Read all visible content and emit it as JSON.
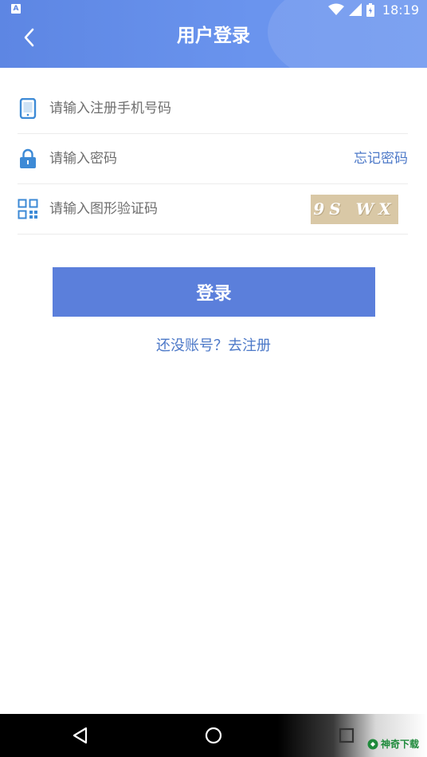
{
  "status_bar": {
    "left_icon_letter": "A",
    "time": "18:19"
  },
  "header": {
    "title": "用户登录"
  },
  "form": {
    "phone_placeholder": "请输入注册手机号码",
    "password_placeholder": "请输入密码",
    "forgot_label": "忘记密码",
    "captcha_placeholder": "请输入图形验证码",
    "captcha_text": "9S WX"
  },
  "login_button_label": "登录",
  "register": {
    "prompt": "还没账号？",
    "action": "去注册"
  },
  "watermark": "神奇下载",
  "colors": {
    "header_blue": "#5d86e3",
    "accent_blue": "#5b7fdb",
    "link_blue": "#4d79c8",
    "icon_blue": "#3d8ad6",
    "captcha_bg": "#d9c8a6"
  }
}
